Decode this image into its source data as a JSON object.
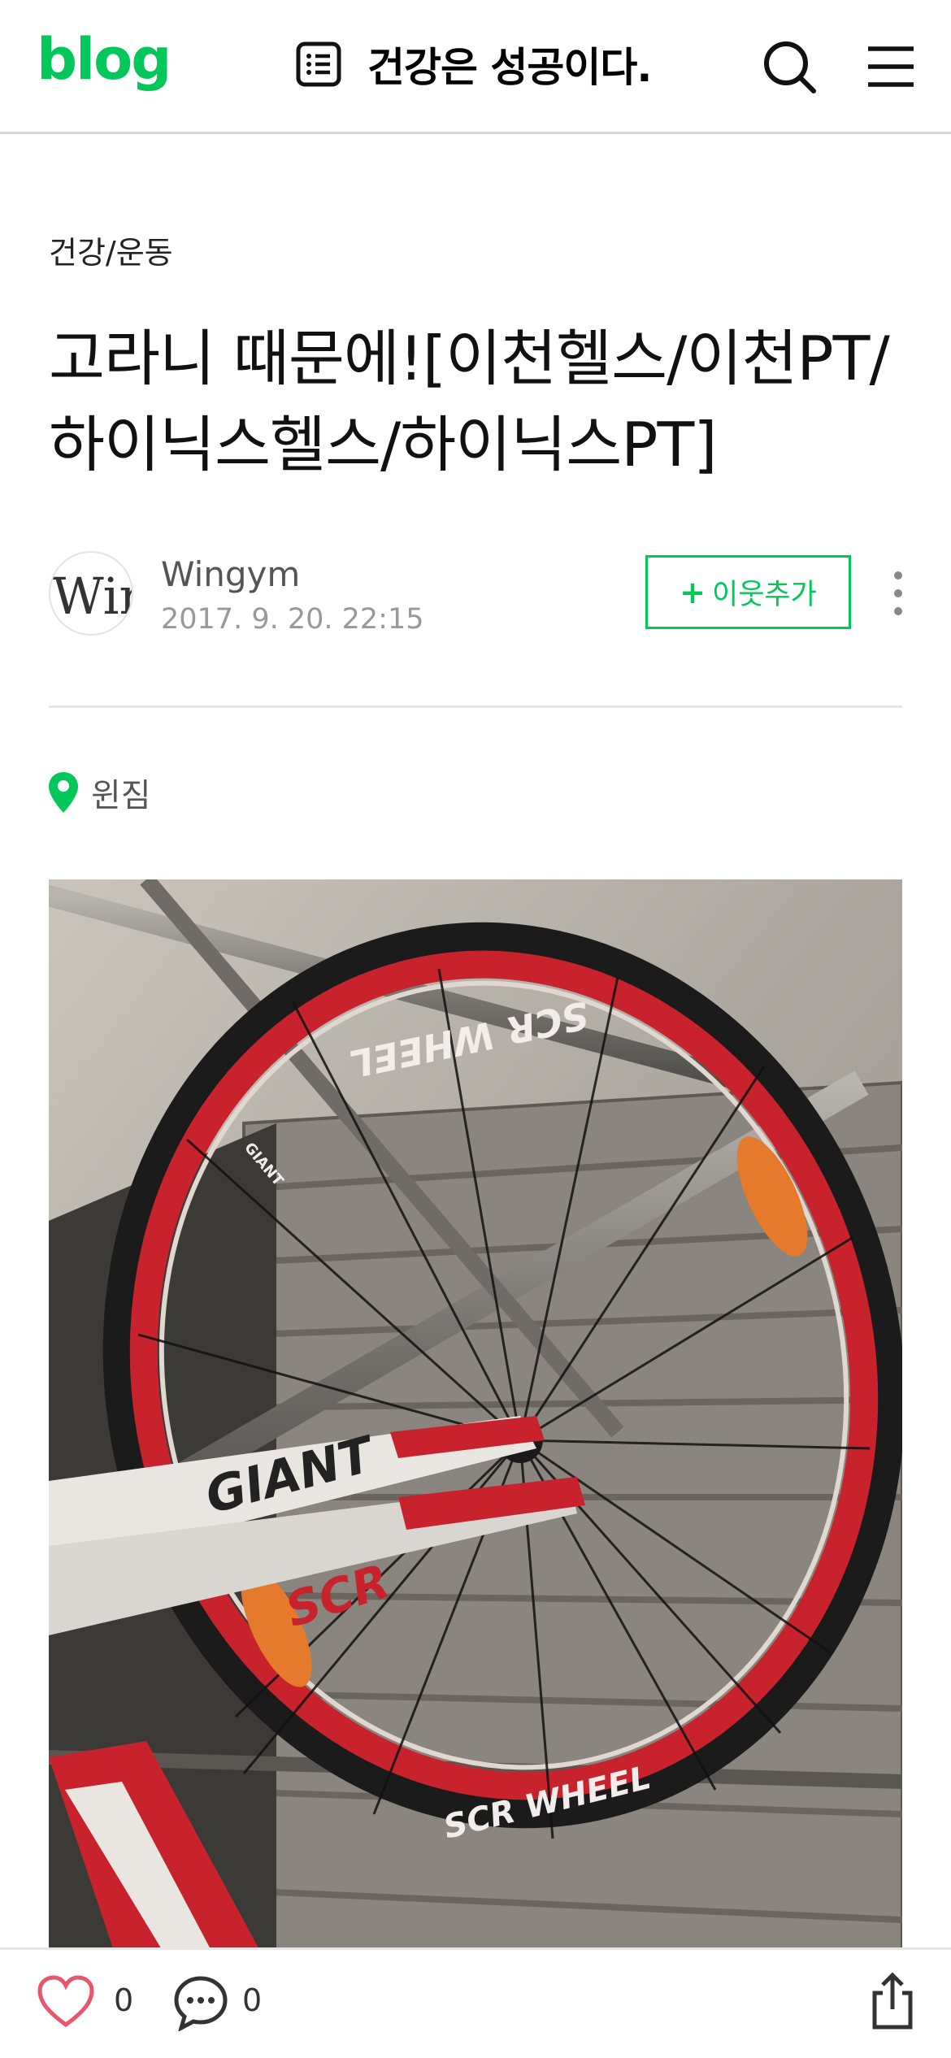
{
  "header": {
    "logo": "blog",
    "blog_title": "건강은 성공이다."
  },
  "post": {
    "category": "건강/운동",
    "title": "고라니 때문에![이천헬스/이천PT/하이닉스헬스/하이닉스PT]",
    "author": "Wingym",
    "date": "2017. 9. 20. 22:15",
    "avatar_text": "Wir",
    "neighbor_button": "이웃추가",
    "neighbor_plus": "+",
    "place": "윈짐",
    "photo_text": {
      "rim_top": "SCR WHEEL",
      "rim_bottom": "SCR WHEEL",
      "frame": "GIANT",
      "frame2": "SCR",
      "rim_giant": "GIANT"
    }
  },
  "footer": {
    "likes": "0",
    "comments": "0"
  },
  "colors": {
    "brand": "#03c75a",
    "like": "#e8556f"
  },
  "icons": [
    "list-icon",
    "search-icon",
    "menu-icon",
    "more-icon",
    "location-pin-icon",
    "heart-icon",
    "comment-icon",
    "share-icon"
  ]
}
